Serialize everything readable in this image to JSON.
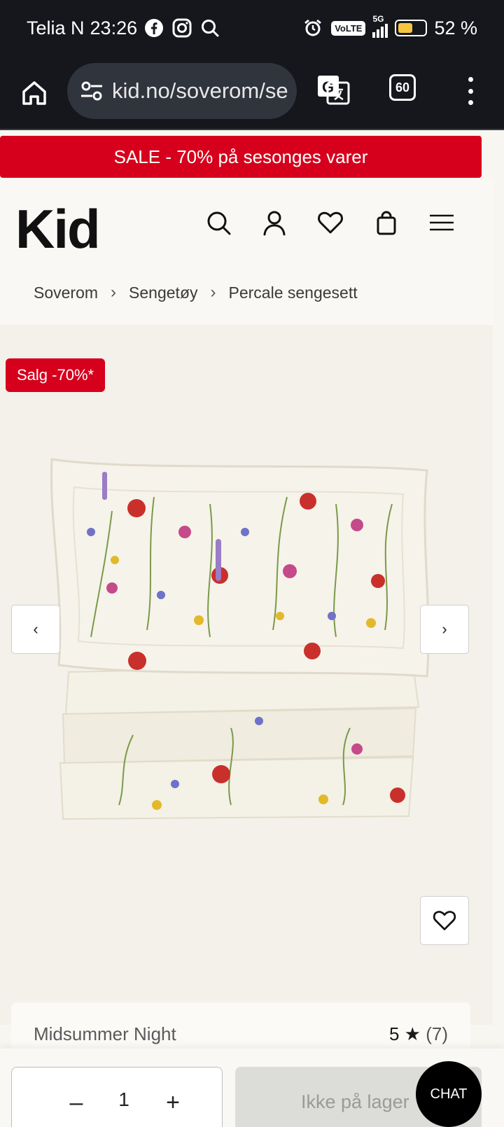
{
  "status_bar": {
    "carrier": "Telia N",
    "time": "23:26",
    "network": "5G",
    "volte": "VoLTE",
    "battery": "52 %",
    "battery_level": 0.52
  },
  "browser": {
    "url": "kid.no/soverom/se",
    "tab_count": "60"
  },
  "banner": {
    "text": "SALE - 70% på sesonges varer",
    "color": "#d6001c"
  },
  "header": {
    "logo": "Kid",
    "icons": [
      "search-icon",
      "user-icon",
      "heart-icon",
      "bag-icon",
      "menu-icon"
    ]
  },
  "breadcrumb": {
    "items": [
      "Soverom",
      "Sengetøy",
      "Percale sengesett"
    ],
    "separator": "›"
  },
  "gallery": {
    "badge": "Salg -70%*",
    "prev": "‹",
    "next": "›"
  },
  "product": {
    "name": "Midsummer Night",
    "rating": "5 ★",
    "review_count": "(7)"
  },
  "bottom_bar": {
    "quantity": "1",
    "minus": "–",
    "plus": "+",
    "buy_label": "Ikke på lager",
    "chat_label": "CHAT"
  }
}
